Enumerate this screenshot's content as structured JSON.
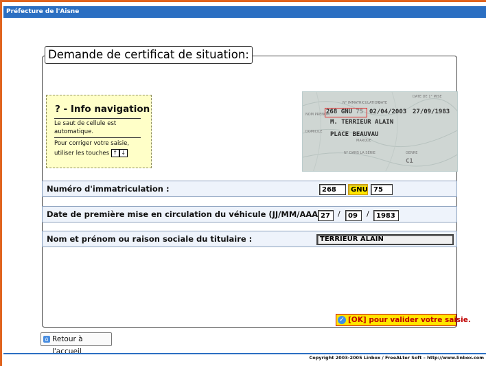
{
  "window": {
    "title": "Préfecture de l'Aisne"
  },
  "form": {
    "legend": "Demande de certificat de situation:",
    "info": {
      "title": "? - Info navigation",
      "line1": "Le saut de cellule est",
      "line2": "automatique.",
      "line3": "Pour corriger votre saisie,",
      "line4": "utiliser les touches",
      "key_up": "↑",
      "key_down": "↓"
    },
    "card_sample": {
      "reg1": "268",
      "reg2": "GNU",
      "reg3": "75",
      "date1": "02/04/2003",
      "date2": "27/09/1983",
      "owner": "M. TERRIEUR ALAIN",
      "address": "PLACE BEAUVAU",
      "code": "C1"
    },
    "registration": {
      "label": "Numéro d'immatriculation :",
      "part1": "268",
      "part2": "GNU",
      "part3": "75"
    },
    "first_date": {
      "label": "Date de première mise en circulation du véhicule (JJ/MM/AAAA):",
      "day": "27",
      "sep1": "/",
      "month": "09",
      "sep2": "/",
      "year": "1983"
    },
    "holder": {
      "label": "Nom et prénom ou raison sociale du titulaire :",
      "value": "TERRIEUR ALAIN"
    },
    "ok_button": {
      "label": "[OK] pour valider votre saisie.",
      "icon": "check-icon"
    },
    "home_button": {
      "label": "Retour à l'accueil",
      "icon": "home-icon"
    }
  },
  "footer": {
    "copyright": "Copyright 2003-2005 Linbox / FreeALter Soft  –  http://www.linbox.com"
  },
  "colors": {
    "frame": "#e0641f",
    "titlebar": "#2b6fc2",
    "info_bg": "#ffffc8",
    "highlight": "#ffe600",
    "ok_text": "#c00000"
  }
}
